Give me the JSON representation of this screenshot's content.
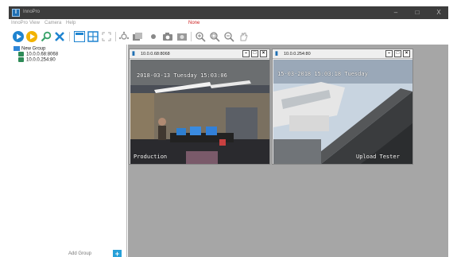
{
  "window": {
    "title": "InnoPro",
    "controls": [
      "–",
      "□",
      "X"
    ]
  },
  "menu": {
    "items": [
      "InnoPro",
      "View",
      "Camera",
      "Help"
    ],
    "center_label": "None"
  },
  "toolbar": {
    "icons": [
      "play-icon",
      "record-icon",
      "search-icon",
      "tools-icon",
      "layout-single-icon",
      "layout-grid-icon",
      "fullscreen-icon",
      "ptz-icon",
      "snapshot-gallery-icon",
      "record-dot-icon",
      "camera-icon",
      "snapshot-icon",
      "zoom-in-icon",
      "zoom-fit-icon",
      "zoom-out-icon",
      "hand-icon"
    ]
  },
  "sidebar": {
    "group_name": "New Group",
    "cameras": [
      "10.0.0.68:8068",
      "10.0.0.254:80"
    ],
    "add_group_label": "Add Group",
    "add_group_button": "+"
  },
  "panes": [
    {
      "title": "10.0.0.68:8068",
      "osd_time": "2018-03-13 Tuesday 15:03:06",
      "osd_label": "Production"
    },
    {
      "title": "10.0.0.254:80",
      "osd_time": "15-03-2018 15:03:18 Tuesday",
      "osd_label": "Upload Tester"
    }
  ],
  "pane_buttons": [
    "–",
    "□",
    "×"
  ],
  "colors": {
    "titlebar": "#3c3c3c",
    "accent": "#27a0d8",
    "workspace": "#a6a6a6",
    "menu_center": "#cc2222"
  }
}
